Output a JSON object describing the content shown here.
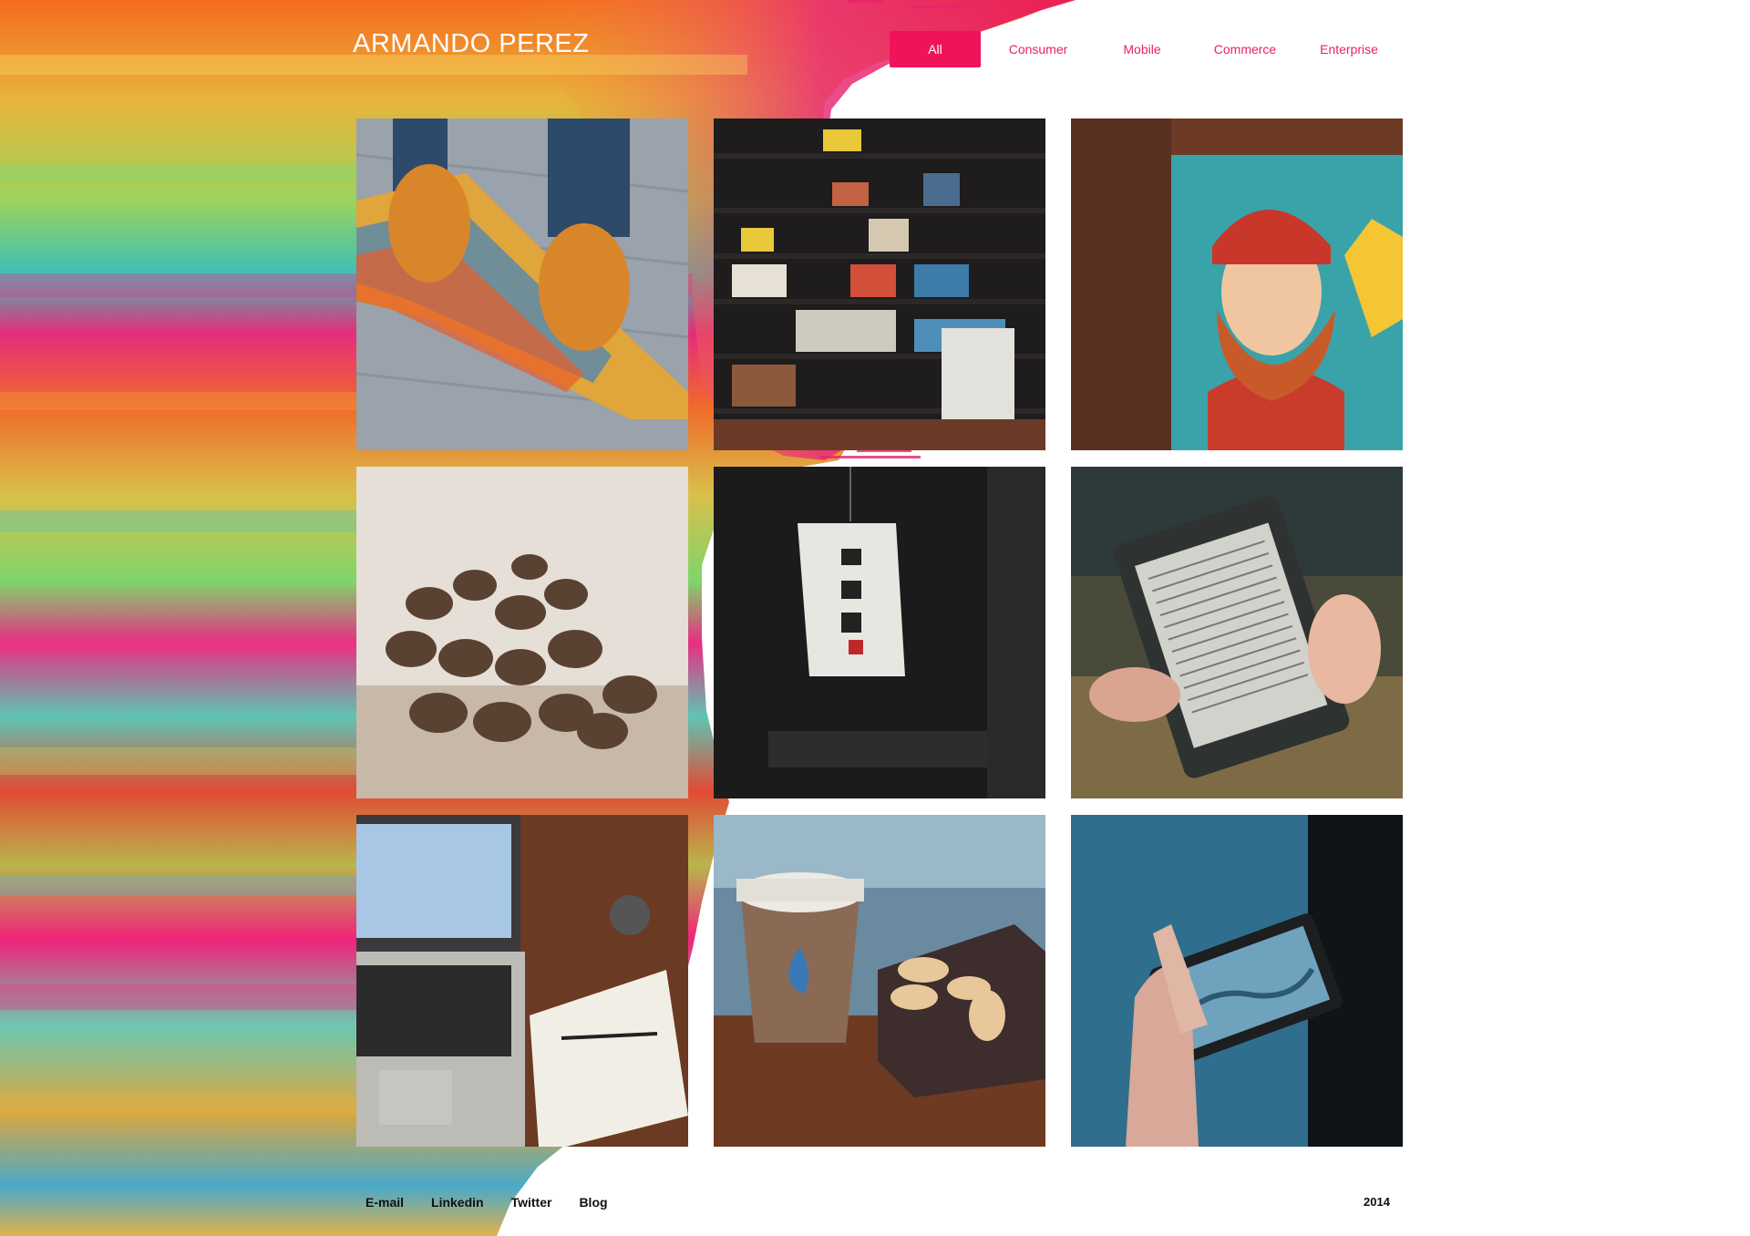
{
  "header": {
    "title": "ARMANDO PEREZ"
  },
  "nav": {
    "items": [
      {
        "label": "All",
        "active": true
      },
      {
        "label": "Consumer",
        "active": false
      },
      {
        "label": "Mobile",
        "active": false
      },
      {
        "label": "Commerce",
        "active": false
      },
      {
        "label": "Enterprise",
        "active": false
      }
    ]
  },
  "gallery": {
    "tiles": [
      {
        "subject": "skateboard-shoes"
      },
      {
        "subject": "bookshelf"
      },
      {
        "subject": "bearded-man-mural"
      },
      {
        "subject": "coffee-beans"
      },
      {
        "subject": "paper-lantern"
      },
      {
        "subject": "kindle-reader"
      },
      {
        "subject": "laptop-notebook"
      },
      {
        "subject": "coffee-cup-macarons"
      },
      {
        "subject": "phone-photo"
      }
    ]
  },
  "footer": {
    "links": [
      "E-mail",
      "Linkedin",
      "Twitter",
      "Blog"
    ],
    "year": "2014"
  },
  "colors": {
    "accent": "#f0135a",
    "nav_text": "#e8245a"
  }
}
